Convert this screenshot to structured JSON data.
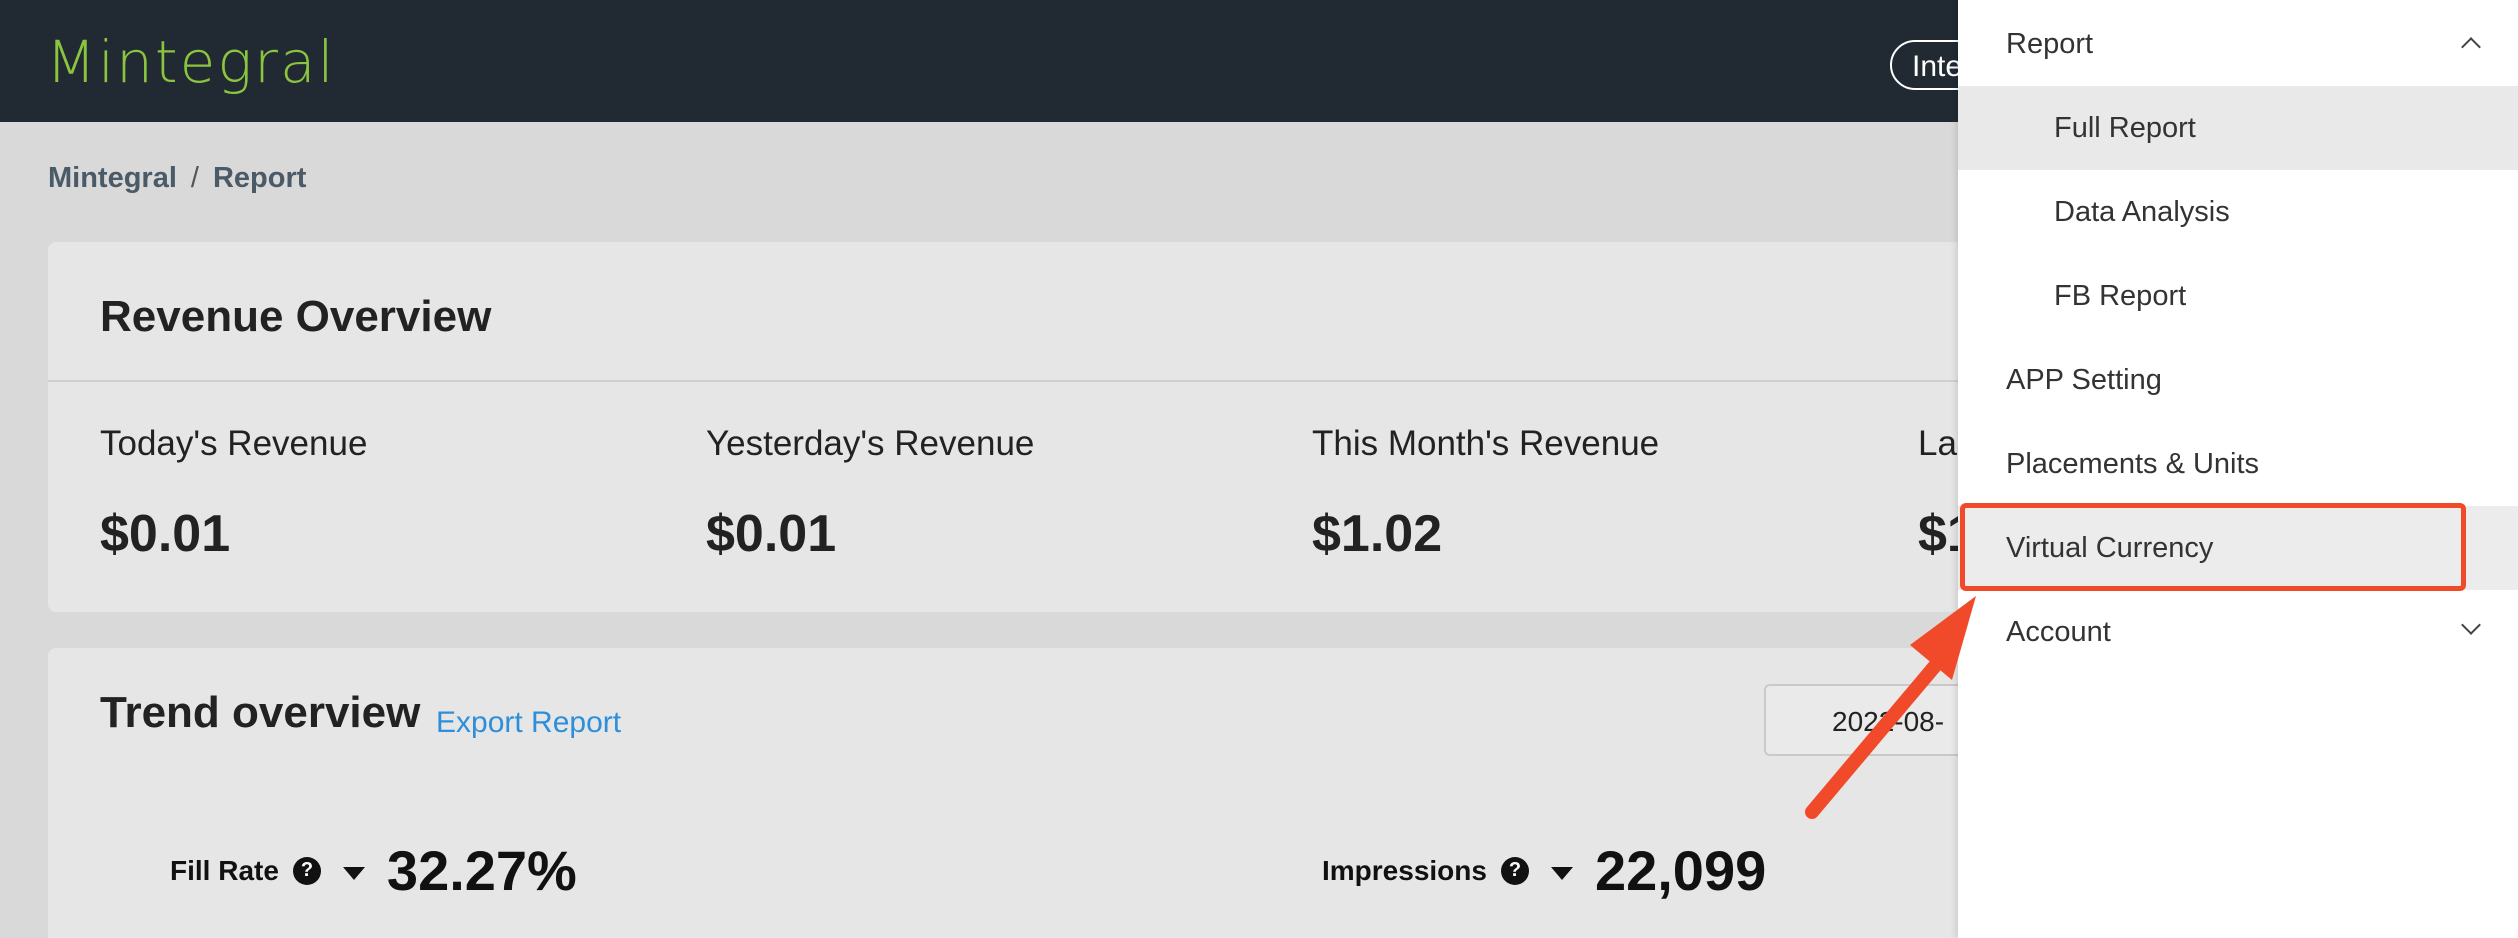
{
  "header": {
    "logo": "Mintegral",
    "integration_button": "Integration"
  },
  "breadcrumb": {
    "home": "Mintegral",
    "separator": "/",
    "current": "Report"
  },
  "revenue_overview": {
    "title": "Revenue Overview",
    "items": [
      {
        "label": "Today's Revenue",
        "value": "$0.01"
      },
      {
        "label": "Yesterday's Revenue",
        "value": "$0.01"
      },
      {
        "label": "This Month's Revenue",
        "value": "$1.02"
      },
      {
        "label": "La",
        "value": "$1"
      }
    ]
  },
  "trend_overview": {
    "title": "Trend overview",
    "export_label": "Export Report",
    "date_range": "2022-08-",
    "metrics": [
      {
        "label": "Fill Rate",
        "value": "32.27%"
      },
      {
        "label": "Impressions",
        "value": "22,099"
      }
    ]
  },
  "menu": {
    "report": "Report",
    "full_report": "Full Report",
    "data_analysis": "Data Analysis",
    "fb_report": "FB Report",
    "app_setting": "APP Setting",
    "placements_units": "Placements & Units",
    "virtual_currency": "Virtual Currency",
    "account": "Account"
  },
  "colors": {
    "header_bg": "#212a33",
    "logo": "#8bc53f",
    "link": "#2d8fd9",
    "highlight": "#f04a2b"
  }
}
